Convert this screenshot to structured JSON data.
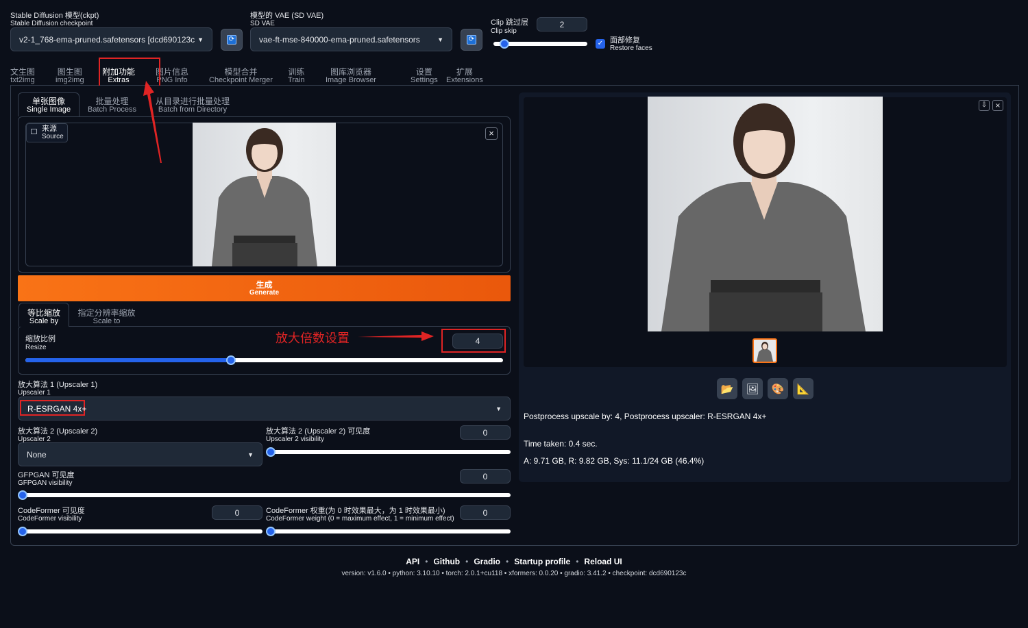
{
  "header": {
    "ckpt_label_zh": "Stable Diffusion 模型(ckpt)",
    "ckpt_label_en": "Stable Diffusion checkpoint",
    "ckpt_value": "v2-1_768-ema-pruned.safetensors [dcd690123c",
    "vae_label_zh": "模型的 VAE (SD VAE)",
    "vae_label_en": "SD VAE",
    "vae_value": "vae-ft-mse-840000-ema-pruned.safetensors",
    "clip_label_zh": "Clip 跳过层",
    "clip_label_en": "Clip skip",
    "clip_value": "2",
    "clip_slider_fraction": 0.12,
    "restore_faces_zh": "面部修复",
    "restore_faces_en": "Restore faces",
    "restore_faces_checked": true,
    "refresh_glyph": "⟳",
    "caret_glyph": "▼"
  },
  "main_tabs": [
    {
      "zh": "文生图",
      "en": "txt2img"
    },
    {
      "zh": "图生图",
      "en": "img2img"
    },
    {
      "zh": "附加功能",
      "en": "Extras"
    },
    {
      "zh": "图片信息",
      "en": "PNG Info"
    },
    {
      "zh": "模型合并",
      "en": "Checkpoint Merger"
    },
    {
      "zh": "训练",
      "en": "Train"
    },
    {
      "zh": "图库浏览器",
      "en": "Image Browser"
    },
    {
      "zh": "设置",
      "en": "Settings"
    },
    {
      "zh": "扩展",
      "en": "Extensions"
    }
  ],
  "sub_tabs": [
    {
      "zh": "单张图像",
      "en": "Single Image"
    },
    {
      "zh": "批量处理",
      "en": "Batch Process"
    },
    {
      "zh": "从目录进行批量处理",
      "en": "Batch from Directory"
    }
  ],
  "source": {
    "zh": "来源",
    "en": "Source",
    "close": "×"
  },
  "generate": {
    "zh": "生成",
    "en": "Generate"
  },
  "scale_tabs": [
    {
      "zh": "等比缩放",
      "en": "Scale by"
    },
    {
      "zh": "指定分辨率缩放",
      "en": "Scale to"
    }
  ],
  "resize": {
    "label_zh": "缩放比例",
    "label_en": "Resize",
    "value": "4",
    "slider_fraction": 0.43
  },
  "annotation": {
    "text": "放大倍数设置"
  },
  "upscaler1": {
    "label_zh": "放大算法 1 (Upscaler 1)",
    "label_en": "Upscaler 1",
    "value": "R-ESRGAN 4x+"
  },
  "upscaler2": {
    "label_zh": "放大算法 2 (Upscaler 2)",
    "label_en": "Upscaler 2",
    "value": "None"
  },
  "upscaler2_vis": {
    "label_zh": "放大算法 2 (Upscaler 2) 可见度",
    "label_en": "Upscaler 2 visibility",
    "value": "0",
    "slider_fraction": 0
  },
  "gfpgan": {
    "label_zh": "GFPGAN 可见度",
    "label_en": "GFPGAN visibility",
    "value": "0",
    "slider_fraction": 0
  },
  "codeformer_vis": {
    "label_zh": "CodeFormer 可见度",
    "label_en": "CodeFormer visibility",
    "value": "0",
    "slider_fraction": 0
  },
  "codeformer_weight": {
    "label_zh": "CodeFormer 权重(为 0 时效果最大，为 1 时效果最小)",
    "label_en": "CodeFormer weight (0 = maximum effect, 1 = minimum effect)",
    "value": "0",
    "slider_fraction": 0
  },
  "output": {
    "download_icon": "⇩",
    "close_icon": "×",
    "info_line": "Postprocess upscale by: 4, Postprocess upscaler: R-ESRGAN 4x+",
    "time_taken": "Time taken: 0.4 sec.",
    "memory": "A: 9.71 GB, R: 9.82 GB, Sys: 11.1/24 GB (46.4%)",
    "action_icons": [
      "📂",
      "🖼",
      "🎨",
      "📐"
    ]
  },
  "footer": {
    "links": [
      "API",
      "Github",
      "Gradio",
      "Startup profile",
      "Reload UI"
    ],
    "version_line": "version: v1.6.0  •  python: 3.10.10  •  torch: 2.0.1+cu118  •  xformers: 0.0.20  •  gradio: 3.41.2  •  checkpoint: dcd690123c"
  },
  "colors": {
    "accent": "#f97316",
    "slider": "#2563eb",
    "annotation_red": "#e02424"
  }
}
